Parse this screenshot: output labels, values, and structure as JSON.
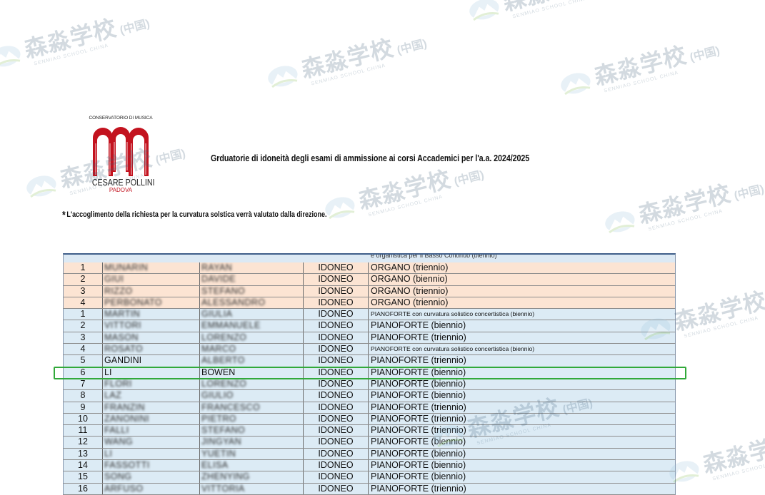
{
  "logo": {
    "institution": "CONSERVATORIO DI MUSICA",
    "name": "CESARE POLLINI",
    "city": "PADOVA"
  },
  "title": "Grduatorie di idoneità degli esami di ammissione ai corsi Accademici per l'a.a. 2024/2025",
  "note": {
    "star": "*",
    "text": "L'accoglimento della richiesta per la curvatura solstica verrà valutato dalla direzione."
  },
  "table": {
    "cutoff_text": "e organistica per il Basso Continuo (biennio)",
    "rows": [
      {
        "num": "1",
        "surname": "MUNARIN",
        "name": "RAYAN",
        "result": "IDONEO",
        "course": "ORGANO (triennio)"
      },
      {
        "num": "2",
        "surname": "GIUI",
        "name": "DAVIDE",
        "result": "IDONEO",
        "course": "ORGANO (biennio)"
      },
      {
        "num": "3",
        "surname": "RIZZO",
        "name": "STEFANO",
        "result": "IDONEO",
        "course": "ORGANO (triennio)"
      },
      {
        "num": "4",
        "surname": "PERBONATO",
        "name": "ALESSANDRO",
        "result": "IDONEO",
        "course": "ORGANO (triennio)"
      },
      {
        "num": "1",
        "surname": "MARTIN",
        "name": "GIULIA",
        "result": "IDONEO",
        "course": "PIANOFORTE con curvatura solistico concertistica (biennio)"
      },
      {
        "num": "2",
        "surname": "VITTORI",
        "name": "EMMANUELE",
        "result": "IDONEO",
        "course": "PIANOFORTE (biennio)"
      },
      {
        "num": "3",
        "surname": "MASON",
        "name": "LORENZO",
        "result": "IDONEO",
        "course": "PIANOFORTE (triennio)"
      },
      {
        "num": "4",
        "surname": "ROSATO",
        "name": "MARCO",
        "result": "IDONEO",
        "course": "PIANOFORTE con curvatura solistico concertistica (biennio)"
      },
      {
        "num": "5",
        "surname": "GANDINI",
        "name": "ALBERTO",
        "result": "IDONEO",
        "course": "PIANOFORTE (triennio)"
      },
      {
        "num": "6",
        "surname": "LI",
        "name": "BOWEN",
        "result": "IDONEO",
        "course": "PIANOFORTE (biennio)"
      },
      {
        "num": "7",
        "surname": "FLORI",
        "name": "LORENZO",
        "result": "IDONEO",
        "course": "PIANOFORTE (biennio)"
      },
      {
        "num": "8",
        "surname": "LAZ",
        "name": "GIULIO",
        "result": "IDONEO",
        "course": "PIANOFORTE (biennio)"
      },
      {
        "num": "9",
        "surname": "FRANZIN",
        "name": "FRANCESCO",
        "result": "IDONEO",
        "course": "PIANOFORTE (triennio)"
      },
      {
        "num": "10",
        "surname": "ZANONINI",
        "name": "PIETRO",
        "result": "IDONEO",
        "course": "PIANOFORTE (triennio)"
      },
      {
        "num": "11",
        "surname": "FALLI",
        "name": "STEFANO",
        "result": "IDONEO",
        "course": "PIANOFORTE (triennio)"
      },
      {
        "num": "12",
        "surname": "WANG",
        "name": "JINGYAN",
        "result": "IDONEO",
        "course": "PIANOFORTE (biennio)"
      },
      {
        "num": "13",
        "surname": "LI",
        "name": "YUETIN",
        "result": "IDONEO",
        "course": "PIANOFORTE (biennio)"
      },
      {
        "num": "14",
        "surname": "FASSOTTI",
        "name": "ELISA",
        "result": "IDONEO",
        "course": "PIANOFORTE (biennio)"
      },
      {
        "num": "15",
        "surname": "SONG",
        "name": "ZHENYING",
        "result": "IDONEO",
        "course": "PIANOFORTE (biennio)"
      },
      {
        "num": "16",
        "surname": "ARFUSO",
        "name": "VITTORIA",
        "result": "IDONEO",
        "course": "PIANOFORTE (triennio)"
      }
    ]
  },
  "watermark": {
    "text": "森淼学校",
    "suffix": "(中国)",
    "sub": "SENMIAO SCHOOL CHINA"
  },
  "colors": {
    "organo_row": "#fce4d3",
    "piano_row": "#dcebf5",
    "logo_red": "#c3131f",
    "highlight": "#31a93a"
  }
}
